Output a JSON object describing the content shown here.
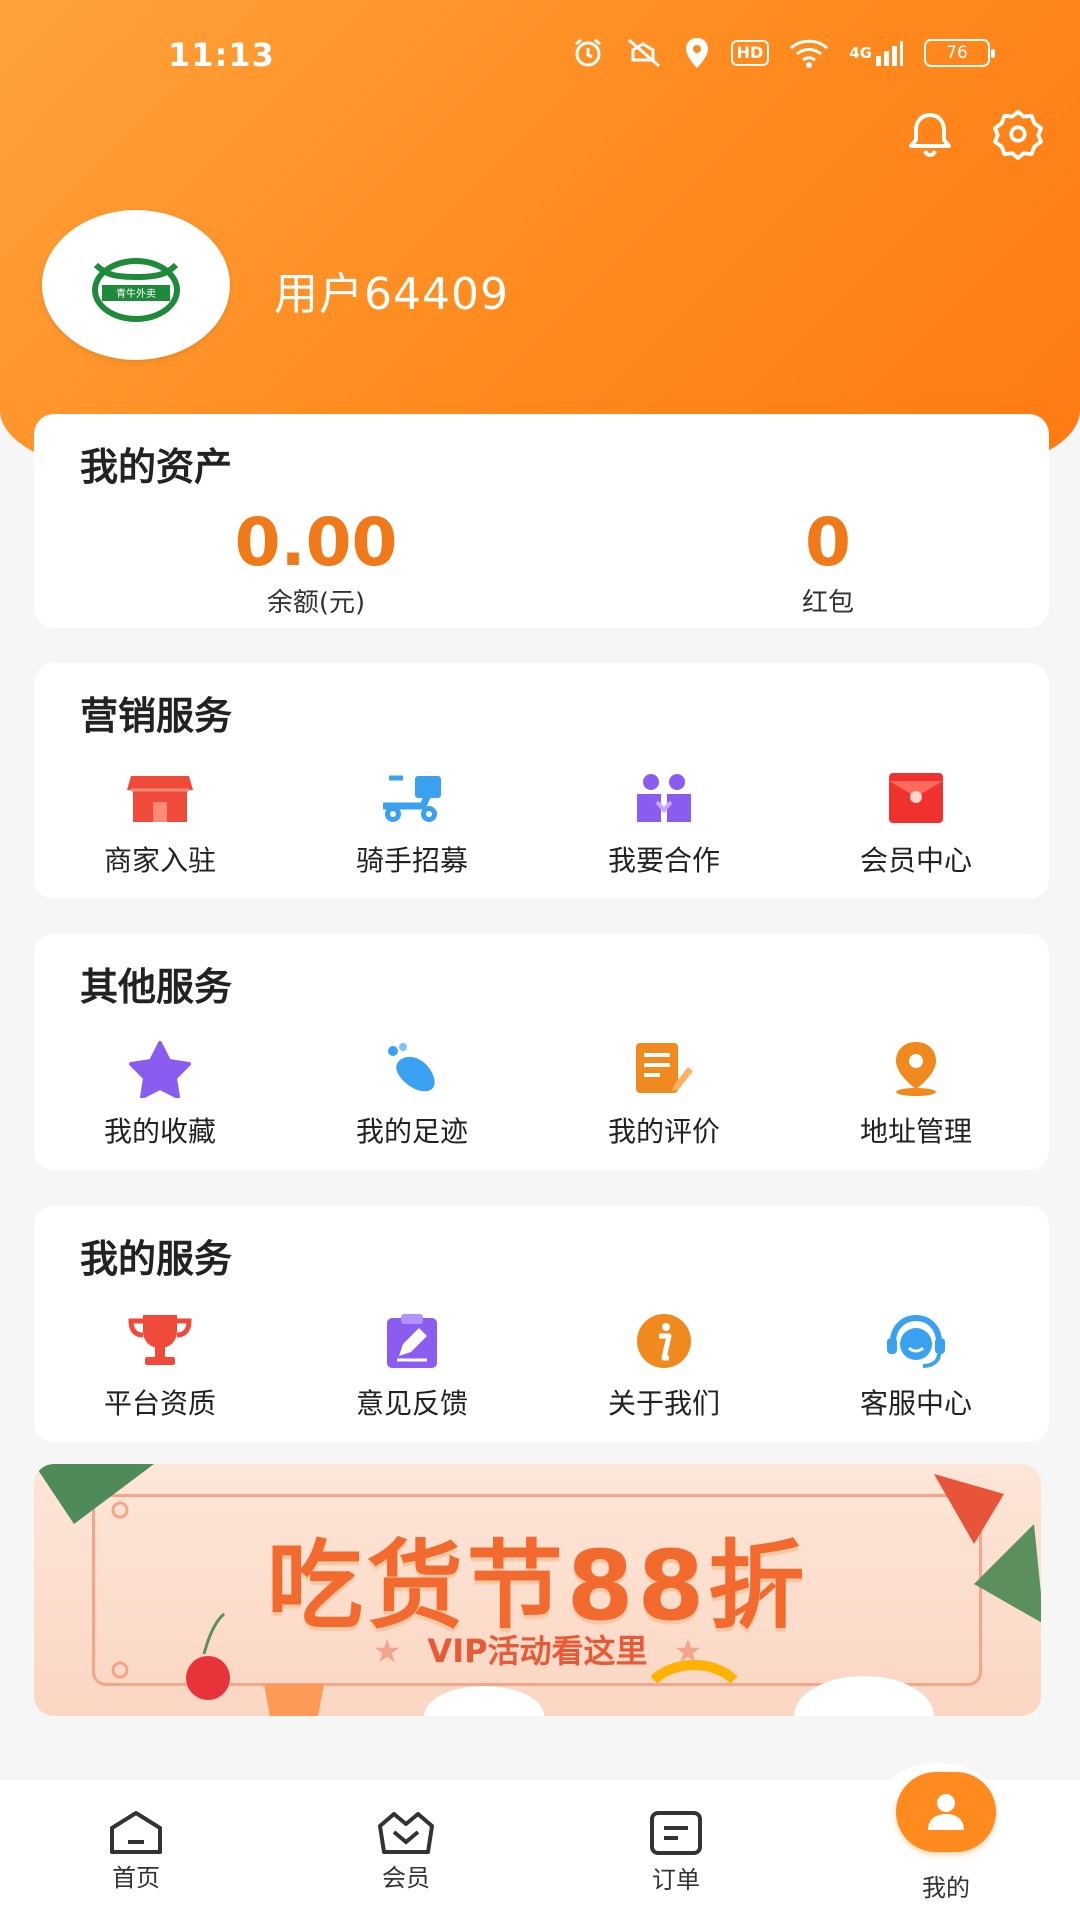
{
  "status_bar": {
    "time": "11:13",
    "hd": "HD",
    "network": "4G",
    "battery": "76"
  },
  "profile": {
    "username": "用户64409",
    "avatar_text": "青牛外卖"
  },
  "assets": {
    "title": "我的资产",
    "balance_value": "0.00",
    "balance_label": "余额(元)",
    "redpack_value": "0",
    "redpack_label": "红包"
  },
  "marketing": {
    "title": "营销服务",
    "items": [
      {
        "label": "商家入驻",
        "icon": "shop-icon",
        "color": "#f04a3a"
      },
      {
        "label": "骑手招募",
        "icon": "scooter-icon",
        "color": "#3aa0f0"
      },
      {
        "label": "我要合作",
        "icon": "partner-icon",
        "color": "#8a5cf0"
      },
      {
        "label": "会员中心",
        "icon": "red-envelope-icon",
        "color": "#f0322e"
      }
    ]
  },
  "other": {
    "title": "其他服务",
    "items": [
      {
        "label": "我的收藏",
        "icon": "star-icon",
        "color": "#8a5cf0"
      },
      {
        "label": "我的足迹",
        "icon": "footprint-icon",
        "color": "#3aa0f0"
      },
      {
        "label": "我的评价",
        "icon": "review-icon",
        "color": "#f08a1e"
      },
      {
        "label": "地址管理",
        "icon": "location-icon",
        "color": "#f08a1e"
      }
    ]
  },
  "mine": {
    "title": "我的服务",
    "items": [
      {
        "label": "平台资质",
        "icon": "trophy-icon",
        "color": "#f04a3a"
      },
      {
        "label": "意见反馈",
        "icon": "feedback-icon",
        "color": "#8a5cf0"
      },
      {
        "label": "关于我们",
        "icon": "info-icon",
        "color": "#f08a1e"
      },
      {
        "label": "客服中心",
        "icon": "headset-icon",
        "color": "#3aa0f0"
      }
    ]
  },
  "banner": {
    "title": "吃货节88折",
    "subtitle": "VIP活动看这里"
  },
  "tabbar": {
    "home": "首页",
    "vip": "会员",
    "order": "订单",
    "mine": "我的"
  },
  "colors": {
    "brand": "#ff8a1e",
    "asset_value": "#f07a1a"
  }
}
